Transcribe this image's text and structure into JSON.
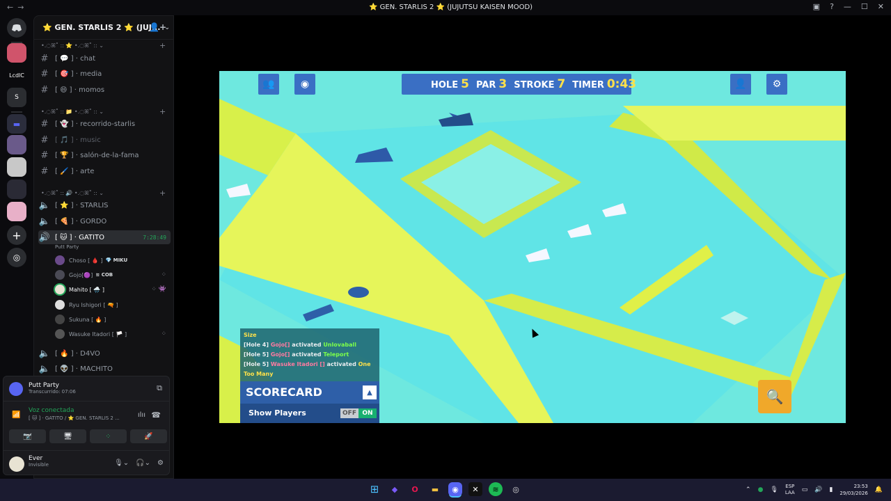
{
  "window": {
    "title": "⭐ GEN. STARLIS 2 ⭐ (JUJUTSU KAISEN MOOD)",
    "nav_back": "←",
    "nav_forward": "→",
    "controls": [
      "▣",
      "?",
      "—",
      "☐",
      "✕"
    ]
  },
  "guilds": [
    {
      "name": "discord-home-icon",
      "label": "",
      "color": "#2b2d31"
    },
    {
      "name": "guild-1",
      "label": "",
      "color": "#d0546b"
    },
    {
      "name": "guild-lcdlc",
      "label": "LcdlC",
      "color": "#0b0b0e"
    },
    {
      "name": "guild-current",
      "label": "S",
      "color": "#2b2d31"
    },
    {
      "name": "guild-folder",
      "label": "",
      "color": "#3b3e8a"
    },
    {
      "name": "guild-2",
      "label": "",
      "color": "#6a5a8a"
    },
    {
      "name": "guild-3",
      "label": "",
      "color": "#c8c8c8"
    },
    {
      "name": "guild-4",
      "label": "",
      "color": "#2a2a35"
    },
    {
      "name": "guild-5",
      "label": "",
      "color": "#e8b0c8"
    }
  ],
  "server": {
    "name": "⭐ GEN. STARLIS 2 ⭐ (JUJ...",
    "chevron": "⌄",
    "add_icon": "👤+"
  },
  "categories": [
    {
      "label": "•.◌ꕤ˚ :: ⭐ •.◌ꕤ˚ :: ⌄",
      "plus": "+"
    },
    {
      "label": "•.◌ꕤ˚ :: 📁 •.◌ꕤ˚ :: ⌄",
      "plus": "+"
    },
    {
      "label": "•.◌ꕤ˚ :: 🔊 •.◌ꕤ˚ :: ⌄",
      "plus": "+"
    }
  ],
  "text_channels": [
    {
      "label": "[  💬  ] · chat",
      "emo": "#6aa0e8"
    },
    {
      "label": "[  🎯  ] · media",
      "emo": "#e86aa0"
    },
    {
      "label": "[  😄  ] · momos",
      "emo": "#e8c86a"
    },
    {
      "label": "[  👻  ] · recorrido-starlis",
      "emo": "#b06ae8"
    },
    {
      "label": "[  🎵  ] · music",
      "emo": "#6a6a8a"
    },
    {
      "label": "[  🏆  ] · salón-de-la-fama",
      "emo": "#e8a06a"
    },
    {
      "label": "[  🖌️  ] · arte",
      "emo": "#e86a6a"
    }
  ],
  "voice_channels": [
    {
      "label": "[  ⭐  ] · STARLIS"
    },
    {
      "label": "[  🍕  ] · GORDO"
    },
    {
      "label": "[  🐱  ] · GATITO",
      "timer": "7:28:49"
    },
    {
      "label": "[  🔥  ] · D4VO"
    },
    {
      "label": "[  👽  ] · MACHITO"
    }
  ],
  "gatito_activity": "Putt Party",
  "voice_users": [
    {
      "name": "Choso [ 🩸 ]",
      "tag": "💎 MIKU",
      "icon": "",
      "color": "#6a4a8a"
    },
    {
      "name": "Gojo[🟣]",
      "tag": "≋ COB",
      "icon": "⁘",
      "color": "#4a4a55"
    },
    {
      "name": "Mahito [ 🌧️ ]",
      "tag": "",
      "icon": "⁘ 👾",
      "color": "#e8e3d3"
    },
    {
      "name": "Ryu Ishigori [ 🔫 ]",
      "tag": "",
      "icon": "",
      "color": "#ddd"
    },
    {
      "name": "Sukuna [ 🔥 ]",
      "tag": "",
      "icon": "",
      "color": "#444"
    },
    {
      "name": "Wasuke Itadori [ 🏳️ ]",
      "tag": "",
      "icon": "⁘",
      "color": "#555"
    }
  ],
  "activity": {
    "name": "Putt Party",
    "elapsed": "Transcurrido: 07:06"
  },
  "voice": {
    "status": "Voz conectada",
    "channel": "[ 🐱 ] · GATITO / ⭐ GEN. STARLIS 2 ...",
    "buttons": [
      "📷̸",
      "🖥",
      "⁘",
      "🚀"
    ]
  },
  "user": {
    "name": "Ever",
    "status": "Invisible"
  },
  "game": {
    "hole_label": "HOLE",
    "hole": "5",
    "par_label": "PAR",
    "par": "3",
    "stroke_label": "STROKE",
    "stroke": "7",
    "timer_label": "TIMER",
    "timer": "0:43",
    "log_title": "Size",
    "log": [
      {
        "prefix": "[Hole 4] ",
        "player": "Gojo[]",
        "mid": " activated ",
        "power": "Unlovaball"
      },
      {
        "prefix": "[Hole 5] ",
        "player": "Gojo[]",
        "mid": " activated ",
        "power": "Teleport"
      },
      {
        "prefix": "[Hole 5] ",
        "player": "Wasuke Itadori []",
        "mid": " activated ",
        "power": "One Too Many"
      }
    ],
    "scorecard": "SCORECARD",
    "show_players": "Show Players",
    "off": "OFF",
    "on": "ON"
  },
  "taskbar": {
    "apps": [
      {
        "name": "windows-start-icon",
        "glyph": "⊞",
        "color": "#4cc2ff"
      },
      {
        "name": "copilot-icon",
        "glyph": "◆",
        "color": "#7a5af8"
      },
      {
        "name": "opera-icon",
        "glyph": "O",
        "color": "#e8174f"
      },
      {
        "name": "file-explorer-icon",
        "glyph": "▬",
        "color": "#f0c040"
      },
      {
        "name": "discord-taskbar-icon",
        "glyph": "◉",
        "color": "#5865f2"
      },
      {
        "name": "capcut-icon",
        "glyph": "✕",
        "color": "#111"
      },
      {
        "name": "spotify-icon",
        "glyph": "≋",
        "color": "#1db954"
      },
      {
        "name": "chrome-icon",
        "glyph": "◎",
        "color": "#333"
      }
    ],
    "lang": "ESP",
    "lang2": "LAA",
    "time": "23:53",
    "date": "29/03/2026"
  }
}
